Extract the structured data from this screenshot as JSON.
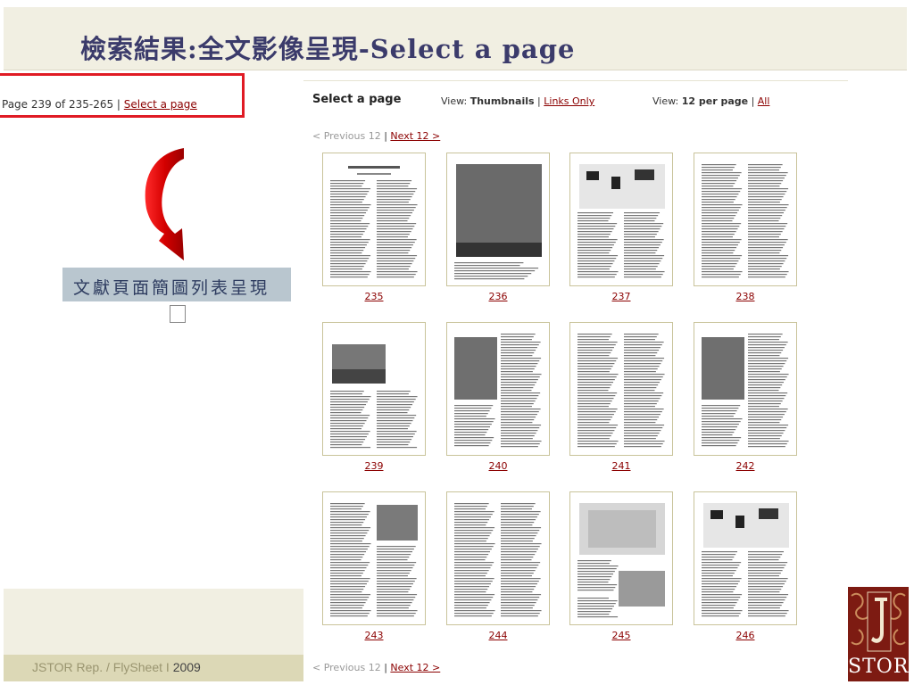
{
  "slide": {
    "title": "檢索結果:全文影像呈現-Select a page",
    "caption": "文獻頁面簡圖列表呈現",
    "footer_source": "JSTOR  Rep. / FlySheet   I  ",
    "footer_year": "2009"
  },
  "page_indicator": {
    "text": "Page 239 of 235-265 | ",
    "select_link": "Select a page"
  },
  "panel": {
    "title": "Select a page",
    "view_label": "View: ",
    "view_thumbnails": "Thumbnails",
    "view_sep": " | ",
    "view_links_only": "Links Only",
    "per_page_label": "View: ",
    "per_page_current": "12 per page",
    "per_page_sep": " | ",
    "per_page_all": "All",
    "prev": "< Previous 12",
    "pager_sep": " | ",
    "next": "Next 12 >"
  },
  "thumbnails": [
    {
      "page": "235"
    },
    {
      "page": "236"
    },
    {
      "page": "237"
    },
    {
      "page": "238"
    },
    {
      "page": "239"
    },
    {
      "page": "240"
    },
    {
      "page": "241"
    },
    {
      "page": "242"
    },
    {
      "page": "243"
    },
    {
      "page": "244"
    },
    {
      "page": "245"
    },
    {
      "page": "246"
    }
  ],
  "logo": {
    "text": "STOR"
  },
  "colors": {
    "accent_red": "#e01b24",
    "link": "#8b0000",
    "title": "#3b3b6b",
    "logo_bg": "#7d1b12"
  }
}
